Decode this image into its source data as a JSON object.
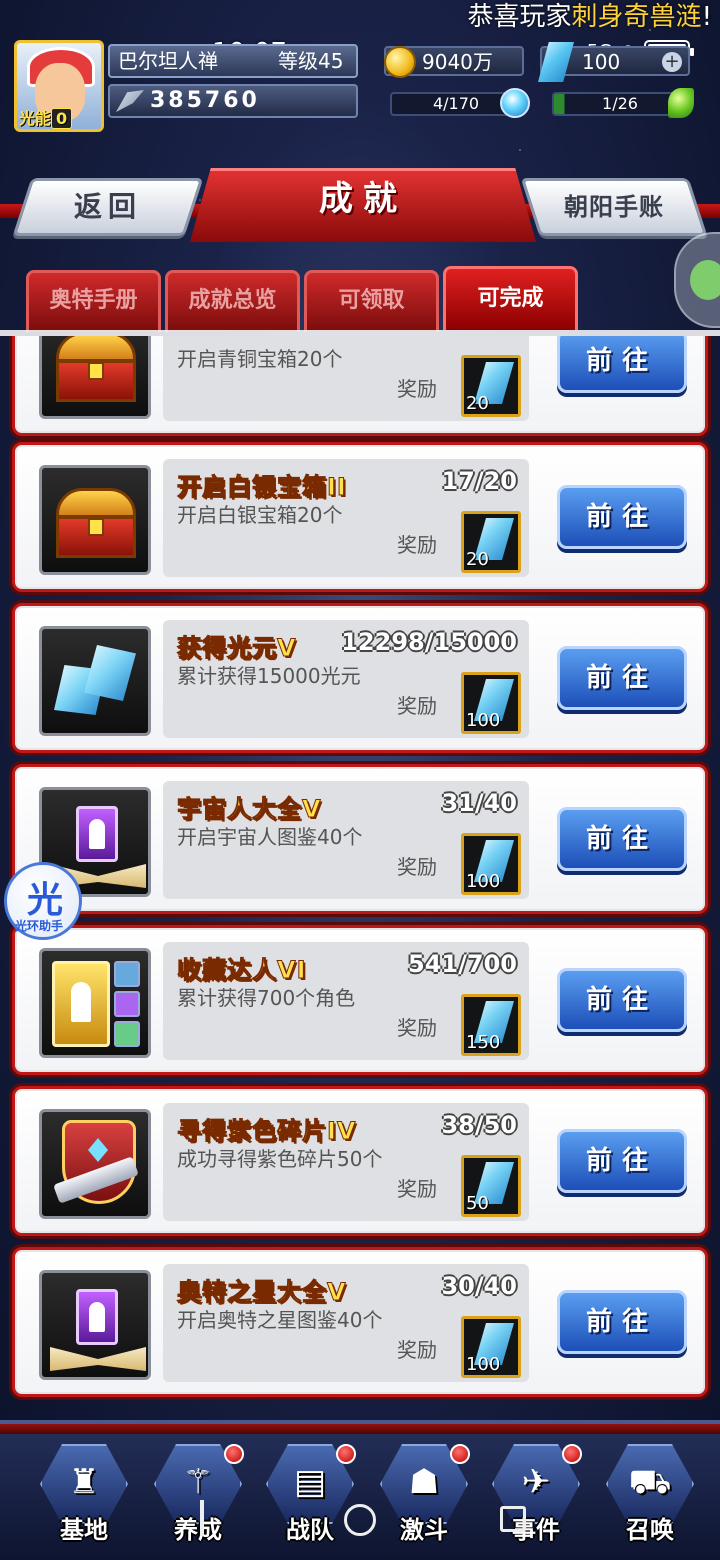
{
  "marquee": {
    "prefix": "恭喜玩家",
    "highlight": "刺身奇兽涟",
    "suffix": "!"
  },
  "status": {
    "time": "10:07",
    "signal": "5G",
    "battery": "100"
  },
  "player": {
    "energy_label": "光能",
    "energy_value": "0",
    "name": "巴尔坦人禅",
    "level": "等级45",
    "power": "385760"
  },
  "resources": {
    "gold": "9040万",
    "gems": "100",
    "orbs": "4/170",
    "leaves": "1/26"
  },
  "header": {
    "back_label": "返回",
    "title": "成就",
    "ledger_label": "朝阳手账"
  },
  "tabs": [
    {
      "label": "奥特手册",
      "active": false
    },
    {
      "label": "成就总览",
      "active": false
    },
    {
      "label": "可领取",
      "active": false
    },
    {
      "label": "可完成",
      "active": true
    }
  ],
  "achievements": [
    {
      "icon": "chest-icon",
      "name": "",
      "progress": "",
      "desc": "开启青铜宝箱20个",
      "reward_label": "奖励",
      "reward_qty": "20",
      "button": "前往"
    },
    {
      "icon": "chest-icon",
      "name": "开启白银宝箱II",
      "progress": "17/20",
      "desc": "开启白银宝箱20个",
      "reward_label": "奖励",
      "reward_qty": "20",
      "button": "前往"
    },
    {
      "icon": "crystal-icon",
      "name": "获得光元V",
      "progress": "12298/15000",
      "desc": "累计获得15000光元",
      "reward_label": "奖励",
      "reward_qty": "100",
      "button": "前往"
    },
    {
      "icon": "monster-book-icon",
      "name": "宇宙人大全V",
      "progress": "31/40",
      "desc": "开启宇宙人图鉴40个",
      "reward_label": "奖励",
      "reward_qty": "100",
      "button": "前往"
    },
    {
      "icon": "collection-icon",
      "name": "收藏达人VI",
      "progress": "541/700",
      "desc": "累计获得700个角色",
      "reward_label": "奖励",
      "reward_qty": "150",
      "button": "前往"
    },
    {
      "icon": "shard-icon",
      "name": "寻得紫色碎片IV",
      "progress": "38/50",
      "desc": "成功寻得紫色碎片50个",
      "reward_label": "奖励",
      "reward_qty": "50",
      "button": "前往"
    },
    {
      "icon": "ultra-book-icon",
      "name": "奥特之星大全V",
      "progress": "30/40",
      "desc": "开启奥特之星图鉴40个",
      "reward_label": "奖励",
      "reward_qty": "100",
      "button": "前往"
    }
  ],
  "helper": {
    "glyph": "光",
    "label": "光环助手"
  },
  "nav": [
    {
      "label": "基地",
      "glyph": "♜",
      "dot": false
    },
    {
      "label": "养成",
      "glyph": "⚚",
      "dot": true
    },
    {
      "label": "战队",
      "glyph": "▤",
      "dot": true
    },
    {
      "label": "激斗",
      "glyph": "☗",
      "dot": true
    },
    {
      "label": "事件",
      "glyph": "✈",
      "dot": true
    },
    {
      "label": "召唤",
      "glyph": "⛟",
      "dot": false
    }
  ]
}
